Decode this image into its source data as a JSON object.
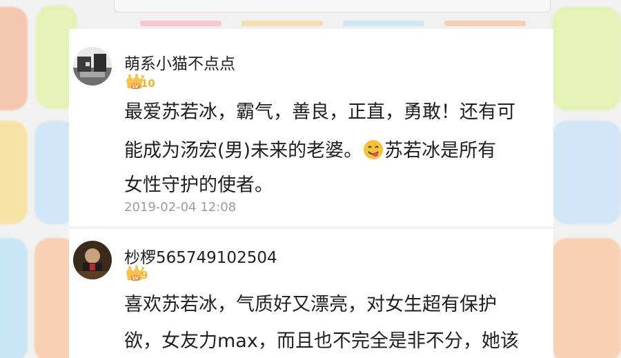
{
  "comments": [
    {
      "username": "萌系小猫不点点",
      "level": "10",
      "level_prefix": "LV",
      "lines": [
        "最爱苏若冰，霸气，善良，正直，勇敢！还有可",
        "能成为汤宏(男)未来的老婆。",
        "苏若冰是所有",
        "女性守护的使者。"
      ],
      "emoji": "savoring-food-emoji",
      "timestamp": "2019-02-04 12:08"
    },
    {
      "username": "杪椤565749102504",
      "level": "9",
      "level_prefix": "LV",
      "lines": [
        "喜欢苏若冰，气质好又漂亮，对女生超有保护",
        "欲，女友力max，而且也不完全是非不分，她该"
      ]
    }
  ],
  "colors": {
    "text": "#1f1f1f",
    "timestamp": "#9b9b9b",
    "level_badge": "#f4b22f",
    "card_bg": "#ffffff",
    "page_bg": "#f1f1f1"
  }
}
